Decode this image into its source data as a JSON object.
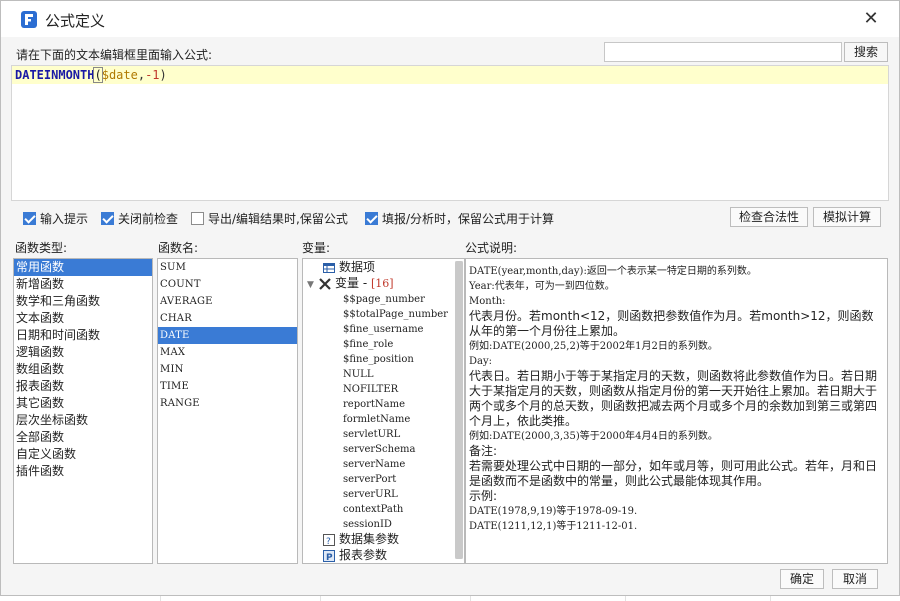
{
  "window": {
    "title": "公式定义"
  },
  "prompt_label": "请在下面的文本编辑框里面输入公式:",
  "search": {
    "value": "",
    "button_label": "搜索"
  },
  "editor": {
    "fn": "DATEINMONTH",
    "open_paren": "(",
    "arg_var": "$date",
    "comma": ",",
    "arg_num": "-1",
    "close_paren": ")"
  },
  "options": [
    {
      "label": "输入提示",
      "checked": true
    },
    {
      "label": "关闭前检查",
      "checked": true
    },
    {
      "label": "导出/编辑结果时,保留公式",
      "checked": false
    },
    {
      "label": "填报/分析时，保留公式用于计算",
      "checked": true
    }
  ],
  "buttons": {
    "check": "检查合法性",
    "simulate": "模拟计算",
    "ok": "确定",
    "cancel": "取消"
  },
  "section_labels": {
    "types": "函数类型:",
    "names": "函数名:",
    "vars": "变量:",
    "desc": "公式说明:"
  },
  "function_types": [
    "常用函数",
    "新增函数",
    "数学和三角函数",
    "文本函数",
    "日期和时间函数",
    "逻辑函数",
    "数组函数",
    "报表函数",
    "其它函数",
    "层次坐标函数",
    "全部函数",
    "自定义函数",
    "插件函数"
  ],
  "function_types_selected": 0,
  "function_names": [
    "SUM",
    "COUNT",
    "AVERAGE",
    "CHAR",
    "DATE",
    "MAX",
    "MIN",
    "TIME",
    "RANGE"
  ],
  "function_names_selected": 4,
  "variables": {
    "data_items": "数据项",
    "var_group": "变量",
    "var_dash": " - ",
    "var_count": "[16]",
    "items": [
      "$$page_number",
      "$$totalPage_number",
      "$fine_username",
      "$fine_role",
      "$fine_position",
      "NULL",
      "NOFILTER",
      "reportName",
      "formletName",
      "servletURL",
      "serverSchema",
      "serverName",
      "serverPort",
      "serverURL",
      "contextPath",
      "sessionID"
    ],
    "dataset_params": "数据集参数",
    "report_params": "报表参数"
  },
  "description": {
    "l1": "DATE(year,month,day):返回一个表示某一特定日期的系列数。",
    "l2": "Year:代表年，可为一到四位数。",
    "l3": "Month:",
    "l4": "代表月份。若month<12，则函数把参数值作为月。若month>12，则函数从年的第一个月份往上累加。",
    "l5": "例如:DATE(2000,25,2)等于2002年1月2日的系列数。",
    "l6": "Day:",
    "l7": "代表日。若日期小于等于某指定月的天数，则函数将此参数值作为日。若日期大于某指定月的天数，则函数从指定月份的第一天开始往上累加。若日期大于两个或多个月的总天数，则函数把减去两个月或多个月的余数加到第三或第四个月上，依此类推。",
    "l8": "例如:DATE(2000,3,35)等于2000年4月4日的系列数。",
    "l9": "备注:",
    "l10": "若需要处理公式中日期的一部分，如年或月等，则可用此公式。若年，月和日是函数而不是函数中的常量，则此公式最能体现其作用。",
    "l11": "示例:",
    "l12": "DATE(1978,9,19)等于1978-09-19.",
    "l13": "DATE(1211,12,1)等于1211-12-01."
  }
}
